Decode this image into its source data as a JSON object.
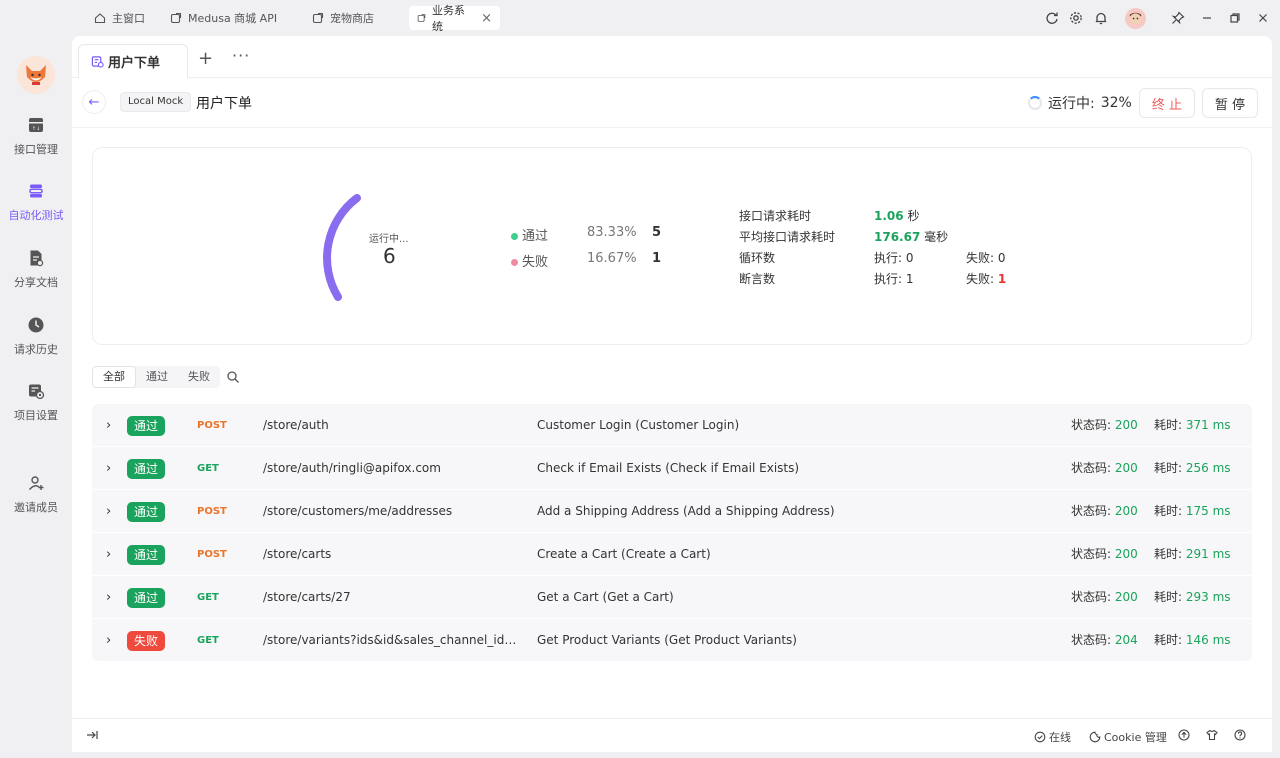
{
  "window": {
    "tabs": [
      {
        "label": "主窗口"
      },
      {
        "label": "Medusa 商城 API"
      },
      {
        "label": "宠物商店"
      },
      {
        "label": "业务系统",
        "close": "×"
      }
    ]
  },
  "sidebar": {
    "items": [
      {
        "label": "接口管理"
      },
      {
        "label": "自动化测试"
      },
      {
        "label": "分享文档"
      },
      {
        "label": "请求历史"
      },
      {
        "label": "项目设置"
      },
      {
        "label": "邀请成员"
      }
    ]
  },
  "doc_tabs": {
    "active": "用户下单",
    "plus": "+",
    "more": "···"
  },
  "header": {
    "env": "Local Mock",
    "title": "用户下单",
    "run_label": "运行中:",
    "progress_text": "32%",
    "progress": 0.32,
    "stop": "终 止",
    "pause": "暂 停"
  },
  "summary": {
    "gauge_label": "运行中...",
    "total": "6",
    "pass_label": "通过",
    "pass_pct": "83.33%",
    "pass_count": "5",
    "fail_label": "失败",
    "fail_pct": "16.67%",
    "fail_count": "1",
    "metrics": {
      "req_time_label": "接口请求耗时",
      "req_time_value": "1.06",
      "req_time_unit": "秒",
      "avg_time_label": "平均接口请求耗时",
      "avg_time_value": "176.67",
      "avg_time_unit": "毫秒",
      "loop_label": "循环数",
      "loop_exec": "执行: 0",
      "loop_fail_label": "失败:",
      "loop_fail_value": "0",
      "assert_label": "断言数",
      "assert_exec": "执行: 1",
      "assert_fail_label": "失败:",
      "assert_fail_value": "1"
    }
  },
  "filters": [
    "全部",
    "通过",
    "失败"
  ],
  "rows": [
    {
      "result": "通过",
      "method": "POST",
      "path": "/store/auth",
      "name": "Customer Login (Customer Login)",
      "status_label": "状态码:",
      "status": "200",
      "time_label": "耗时:",
      "time": "371 ms"
    },
    {
      "result": "通过",
      "method": "GET",
      "path": "/store/auth/ringli@apifox.com",
      "name": "Check if Email Exists (Check if Email Exists)",
      "status_label": "状态码:",
      "status": "200",
      "time_label": "耗时:",
      "time": "256 ms"
    },
    {
      "result": "通过",
      "method": "POST",
      "path": "/store/customers/me/addresses",
      "name": "Add a Shipping Address (Add a Shipping Address)",
      "status_label": "状态码:",
      "status": "200",
      "time_label": "耗时:",
      "time": "175 ms"
    },
    {
      "result": "通过",
      "method": "POST",
      "path": "/store/carts",
      "name": "Create a Cart (Create a Cart)",
      "status_label": "状态码:",
      "status": "200",
      "time_label": "耗时:",
      "time": "291 ms"
    },
    {
      "result": "通过",
      "method": "GET",
      "path": "/store/carts/27",
      "name": "Get a Cart (Get a Cart)",
      "status_label": "状态码:",
      "status": "200",
      "time_label": "耗时:",
      "time": "293 ms"
    },
    {
      "result": "失败",
      "method": "GET",
      "path": "/store/variants?ids&id&sales_channel_id&exp...",
      "name": "Get Product Variants (Get Product Variants)",
      "status_label": "状态码:",
      "status": "204",
      "time_label": "耗时:",
      "time": "146 ms"
    }
  ],
  "footer": {
    "online": "在线",
    "cookie": "Cookie 管理"
  },
  "colors": {
    "accent": "#7a5af8",
    "pass": "#1aa35c",
    "fail": "#ee4a3e",
    "post": "#e8752b"
  }
}
